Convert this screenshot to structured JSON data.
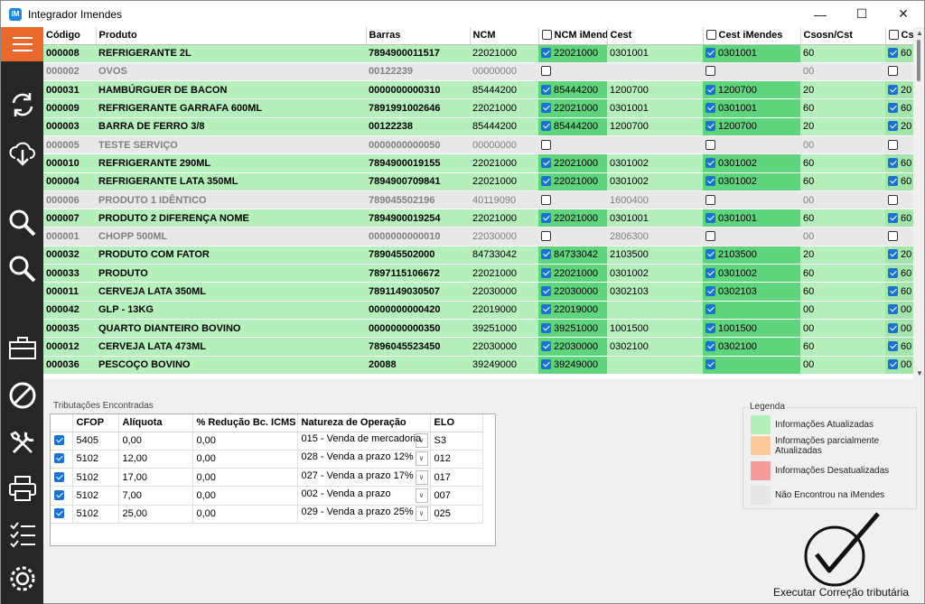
{
  "window": {
    "title": "Integrador Imendes",
    "logo_text": "IM"
  },
  "grid": {
    "columns": [
      "Código",
      "Produto",
      "Barras",
      "NCM",
      "NCM iMendes",
      "Cest",
      "Cest iMendes",
      "Csosn/Cst",
      "Cs"
    ],
    "rows": [
      {
        "status": "g",
        "codigo": "000008",
        "produto": "REFRIGERANTE  2L",
        "barras": "7894900011517",
        "ncm": "22021000",
        "ncm_im_checked": true,
        "ncm_im": "22021000",
        "cest": "0301001",
        "cest_im_checked": true,
        "cest_im": "0301001",
        "csosn": "60",
        "cs_checked": true,
        "cs": "60"
      },
      {
        "status": "x",
        "codigo": "000002",
        "produto": "OVOS",
        "barras": "00122239",
        "ncm": "00000000",
        "ncm_im_checked": false,
        "ncm_im": "",
        "cest": "",
        "cest_im_checked": false,
        "cest_im": "",
        "csosn": "00",
        "cs_checked": false,
        "cs": ""
      },
      {
        "status": "g",
        "codigo": "000031",
        "produto": "HAMBÚRGUER DE BACON",
        "barras": "0000000000310",
        "ncm": "85444200",
        "ncm_im_checked": true,
        "ncm_im": "85444200",
        "cest": "1200700",
        "cest_im_checked": true,
        "cest_im": "1200700",
        "csosn": "20",
        "cs_checked": true,
        "cs": "20"
      },
      {
        "status": "g",
        "codigo": "000009",
        "produto": "REFRIGERANTE GARRAFA 600ML",
        "barras": "7891991002646",
        "ncm": "22021000",
        "ncm_im_checked": true,
        "ncm_im": "22021000",
        "cest": "0301001",
        "cest_im_checked": true,
        "cest_im": "0301001",
        "csosn": "60",
        "cs_checked": true,
        "cs": "60"
      },
      {
        "status": "g",
        "codigo": "000003",
        "produto": "BARRA DE FERRO 3/8",
        "barras": "00122238",
        "ncm": "85444200",
        "ncm_im_checked": true,
        "ncm_im": "85444200",
        "cest": "1200700",
        "cest_im_checked": true,
        "cest_im": "1200700",
        "csosn": "20",
        "cs_checked": true,
        "cs": "20"
      },
      {
        "status": "x",
        "codigo": "000005",
        "produto": "TESTE SERVIÇO",
        "barras": "0000000000050",
        "ncm": "00000000",
        "ncm_im_checked": false,
        "ncm_im": "",
        "cest": "",
        "cest_im_checked": false,
        "cest_im": "",
        "csosn": "00",
        "cs_checked": false,
        "cs": ""
      },
      {
        "status": "g",
        "codigo": "000010",
        "produto": "REFRIGERANTE 290ML",
        "barras": "7894900019155",
        "ncm": "22021000",
        "ncm_im_checked": true,
        "ncm_im": "22021000",
        "cest": "0301002",
        "cest_im_checked": true,
        "cest_im": "0301002",
        "csosn": "60",
        "cs_checked": true,
        "cs": "60"
      },
      {
        "status": "g",
        "codigo": "000004",
        "produto": "REFRIGERANTE LATA 350ML",
        "barras": "7894900709841",
        "ncm": "22021000",
        "ncm_im_checked": true,
        "ncm_im": "22021000",
        "cest": "0301002",
        "cest_im_checked": true,
        "cest_im": "0301002",
        "csosn": "60",
        "cs_checked": true,
        "cs": "60"
      },
      {
        "status": "x",
        "codigo": "000006",
        "produto": "PRODUTO 1 IDÊNTICO",
        "barras": "789045502196",
        "ncm": "40119090",
        "ncm_im_checked": false,
        "ncm_im": "",
        "cest": "1600400",
        "cest_im_checked": false,
        "cest_im": "",
        "csosn": "00",
        "cs_checked": false,
        "cs": ""
      },
      {
        "status": "g",
        "codigo": "000007",
        "produto": "PRODUTO 2 DIFERENÇA NOME",
        "barras": "7894900019254",
        "ncm": "22021000",
        "ncm_im_checked": true,
        "ncm_im": "22021000",
        "cest": "0301001",
        "cest_im_checked": true,
        "cest_im": "0301001",
        "csosn": "60",
        "cs_checked": true,
        "cs": "60"
      },
      {
        "status": "x",
        "codigo": "000001",
        "produto": "CHOPP 500ML",
        "barras": "0000000000010",
        "ncm": "22030000",
        "ncm_im_checked": false,
        "ncm_im": "",
        "cest": "2806300",
        "cest_im_checked": false,
        "cest_im": "",
        "csosn": "00",
        "cs_checked": false,
        "cs": ""
      },
      {
        "status": "g",
        "codigo": "000032",
        "produto": "PRODUTO COM FATOR",
        "barras": "789045502000",
        "ncm": "84733042",
        "ncm_im_checked": true,
        "ncm_im": "84733042",
        "cest": "2103500",
        "cest_im_checked": true,
        "cest_im": "2103500",
        "csosn": "20",
        "cs_checked": true,
        "cs": "20"
      },
      {
        "status": "g",
        "codigo": "000033",
        "produto": "PRODUTO",
        "barras": "7897115106672",
        "ncm": "22021000",
        "ncm_im_checked": true,
        "ncm_im": "22021000",
        "cest": "0301002",
        "cest_im_checked": true,
        "cest_im": "0301002",
        "csosn": "60",
        "cs_checked": true,
        "cs": "60"
      },
      {
        "status": "g",
        "codigo": "000011",
        "produto": "CERVEJA LATA 350ML",
        "barras": "7891149030507",
        "ncm": "22030000",
        "ncm_im_checked": true,
        "ncm_im": "22030000",
        "cest": "0302103",
        "cest_im_checked": true,
        "cest_im": "0302103",
        "csosn": "60",
        "cs_checked": true,
        "cs": "60"
      },
      {
        "status": "g",
        "codigo": "000042",
        "produto": "GLP - 13KG",
        "barras": "0000000000420",
        "ncm": "22019000",
        "ncm_im_checked": true,
        "ncm_im": "22019000",
        "cest": "",
        "cest_im_checked": true,
        "cest_im": "",
        "csosn": "00",
        "cs_checked": true,
        "cs": "00"
      },
      {
        "status": "g",
        "codigo": "000035",
        "produto": "QUARTO DIANTEIRO BOVINO",
        "barras": "0000000000350",
        "ncm": "39251000",
        "ncm_im_checked": true,
        "ncm_im": "39251000",
        "cest": "1001500",
        "cest_im_checked": true,
        "cest_im": "1001500",
        "csosn": "00",
        "cs_checked": true,
        "cs": "00"
      },
      {
        "status": "g",
        "codigo": "000012",
        "produto": "CERVEJA LATA 473ML",
        "barras": "7896045523450",
        "ncm": "22030000",
        "ncm_im_checked": true,
        "ncm_im": "22030000",
        "cest": "0302100",
        "cest_im_checked": true,
        "cest_im": "0302100",
        "csosn": "60",
        "cs_checked": true,
        "cs": "60"
      },
      {
        "status": "g",
        "codigo": "000036",
        "produto": "PESCOÇO BOVINO",
        "barras": "20088",
        "ncm": "39249000",
        "ncm_im_checked": true,
        "ncm_im": "39249000",
        "cest": "",
        "cest_im_checked": true,
        "cest_im": "",
        "csosn": "00",
        "cs_checked": true,
        "cs": "00"
      }
    ]
  },
  "tributacoes": {
    "title": "Tributações Encontradas",
    "columns": [
      "CFOP",
      "Alíquota",
      "% Redução Bc. ICMS",
      "Natureza de Operação",
      "ELO"
    ],
    "rows": [
      {
        "checked": true,
        "cfop": "5405",
        "aliquota": "0,00",
        "reducao": "0,00",
        "natureza": "015 - Venda de mercadoria",
        "elo": "S3"
      },
      {
        "checked": true,
        "cfop": "5102",
        "aliquota": "12,00",
        "reducao": "0,00",
        "natureza": "028 - Venda a prazo 12%",
        "elo": "012"
      },
      {
        "checked": true,
        "cfop": "5102",
        "aliquota": "17,00",
        "reducao": "0,00",
        "natureza": "027 - Venda a prazo 17%",
        "elo": "017"
      },
      {
        "checked": true,
        "cfop": "5102",
        "aliquota": "7,00",
        "reducao": "0,00",
        "natureza": "002 - Venda a prazo",
        "elo": "007"
      },
      {
        "checked": true,
        "cfop": "5102",
        "aliquota": "25,00",
        "reducao": "0,00",
        "natureza": "029 - Venda a prazo 25%",
        "elo": "025"
      }
    ]
  },
  "legenda": {
    "title": "Legenda",
    "items": [
      {
        "label": "Informações Atualizadas",
        "color": "#b5efbb"
      },
      {
        "label": "Informações parcialmente Atualizadas",
        "color": "#fbc99b"
      },
      {
        "label": "Informações Desatualizadas",
        "color": "#f59b9b"
      },
      {
        "label": "Não Encontrou na iMendes",
        "color": "#e6e6e6"
      }
    ]
  },
  "executar": {
    "label": "Executar Correção tributária"
  },
  "sidebar": {
    "accent": "#e8692b",
    "icons": [
      "menu-icon",
      "sync-icon",
      "cloud-download-icon",
      "search-icon",
      "search-alt-icon",
      "toolbox-icon",
      "cancel-icon",
      "tools-icon",
      "printer-icon",
      "checklist-icon",
      "settings-icon"
    ]
  }
}
